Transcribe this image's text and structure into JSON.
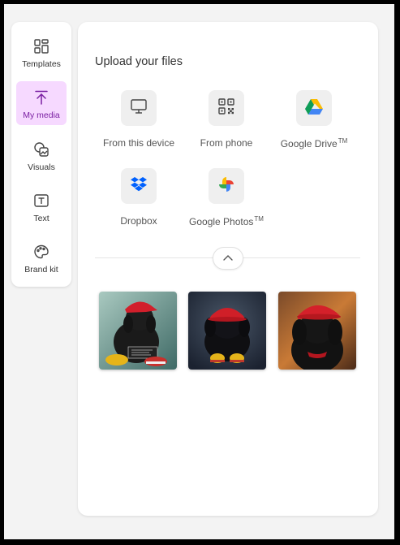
{
  "sidebar": {
    "items": [
      {
        "label": "Templates",
        "icon": "templates-icon",
        "active": false
      },
      {
        "label": "My media",
        "icon": "upload-icon",
        "active": true
      },
      {
        "label": "Visuals",
        "icon": "visuals-icon",
        "active": false
      },
      {
        "label": "Text",
        "icon": "text-icon",
        "active": false
      },
      {
        "label": "Brand kit",
        "icon": "palette-icon",
        "active": false
      }
    ],
    "active_color": "#7a1fa2",
    "active_bg": "#f6d9ff"
  },
  "upload": {
    "title": "Upload your files",
    "sources": [
      {
        "label": "From this device",
        "icon": "monitor-icon"
      },
      {
        "label": "From phone",
        "icon": "qr-code-icon"
      },
      {
        "label": "Google Drive",
        "tm": "TM",
        "icon": "google-drive-icon"
      },
      {
        "label": "Dropbox",
        "icon": "dropbox-icon"
      },
      {
        "label": "Google Photos",
        "tm": "TM",
        "icon": "google-photos-icon"
      }
    ]
  },
  "collapse": {
    "icon": "chevron-up-icon"
  },
  "media": {
    "images": [
      {
        "name": "black dog with red cap and yellow sneakers holding sign"
      },
      {
        "name": "black fluffy dog with red hat and yellow shoes"
      },
      {
        "name": "black dog with red hat in autumn setting"
      }
    ]
  }
}
